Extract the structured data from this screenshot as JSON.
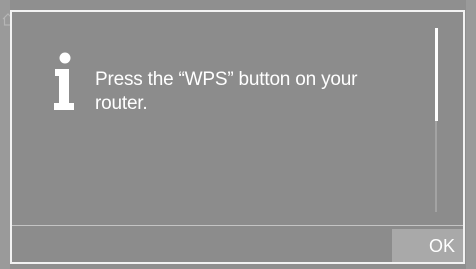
{
  "dialog": {
    "icon": "info-icon",
    "message": "Press the “WPS” button on your router.",
    "ok_label": "OK"
  },
  "scrollbar": {
    "visible_fraction": 0.5,
    "position": 0
  },
  "colors": {
    "screen_background": "#8f8f8f",
    "dialog_border": "#f2f2f2",
    "text": "#ffffff",
    "button_background": "#a9a9a9"
  }
}
